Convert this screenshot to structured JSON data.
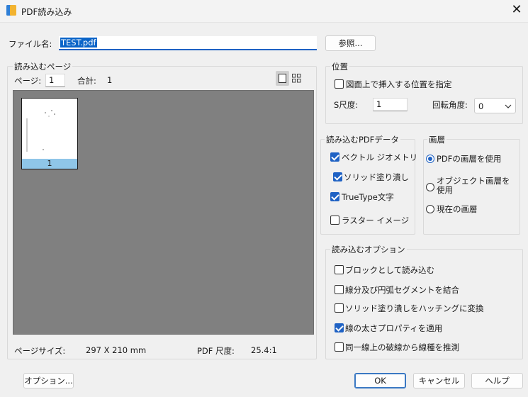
{
  "window": {
    "title": "PDF読み込み"
  },
  "file": {
    "label": "ファイル名:",
    "value": "TEST.pdf",
    "browse_button": "参照..."
  },
  "pages_group": {
    "legend": "読み込むページ",
    "page_label": "ページ:",
    "page_value": "1",
    "total_label": "合計:",
    "total_value": "1",
    "thumbnail_number": "1",
    "page_size_label": "ページサイズ:",
    "page_size_value": "297 X 210 mm",
    "pdf_scale_label": "PDF 尺度:",
    "pdf_scale_value": "25.4:1"
  },
  "position_group": {
    "legend": "位置",
    "specify_label": "図面上で挿入する位置を指定",
    "specify_checked": false,
    "scale_label": "S尺度:",
    "scale_value": "1",
    "rotation_label": "回転角度:",
    "rotation_value": "0"
  },
  "pdf_data_group": {
    "legend": "読み込むPDFデータ",
    "items": [
      {
        "label": "ベクトル ジオメトリ",
        "checked": true
      },
      {
        "label": "ソリッド塗り潰し",
        "checked": true
      },
      {
        "label": "TrueType文字",
        "checked": true
      },
      {
        "label": "ラスター イメージ",
        "checked": false
      }
    ]
  },
  "layer_group": {
    "legend": "画層",
    "options": [
      {
        "label": "PDFの画層を使用",
        "selected": true
      },
      {
        "label": "オブジェクト画層を使用",
        "selected": false
      },
      {
        "label": "現在の画層",
        "selected": false
      }
    ]
  },
  "options_group": {
    "legend": "読み込むオプション",
    "items": [
      {
        "label": "ブロックとして読み込む",
        "checked": false
      },
      {
        "label": "線分及び円弧セグメントを結合",
        "checked": false
      },
      {
        "label": "ソリッド塗り潰しをハッチングに変換",
        "checked": false
      },
      {
        "label": "線の太さプロパティを適用",
        "checked": true
      },
      {
        "label": "同一線上の破線から線種を推測",
        "checked": false
      }
    ]
  },
  "buttons": {
    "options": "オプション...",
    "ok": "OK",
    "cancel": "キャンセル",
    "help": "ヘルプ"
  },
  "icons": {
    "app": "pdf-import-app-icon",
    "close": "close-icon",
    "single_view": "single-page-view-icon",
    "grid_view": "thumbnail-grid-view-icon",
    "dropdown": "chevron-down-icon"
  },
  "colors": {
    "accent": "#1f62c4",
    "preview_bg": "#808080",
    "thumb_label_bg": "#8fc6e8"
  }
}
